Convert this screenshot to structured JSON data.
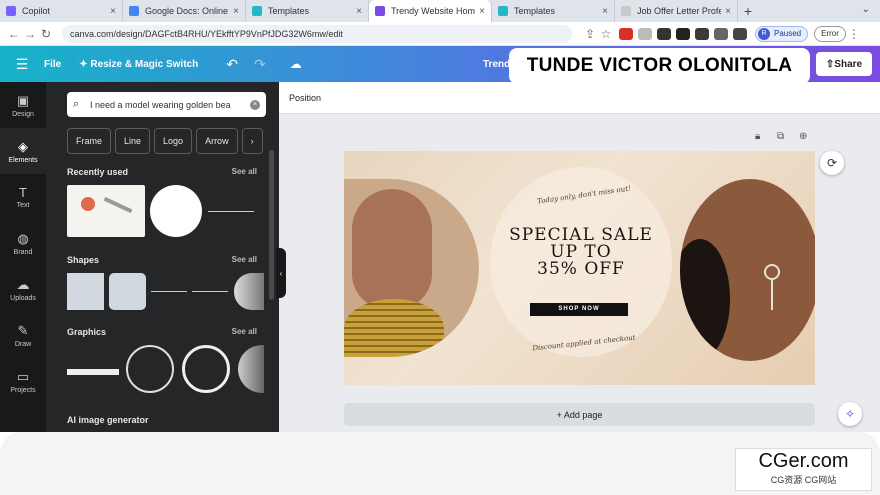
{
  "browser": {
    "tabs": [
      {
        "title": "Copilot",
        "color": "#7b61ff"
      },
      {
        "title": "Google Docs: Online D",
        "color": "#4285f4"
      },
      {
        "title": "Templates",
        "color": "#26b5c9"
      },
      {
        "title": "Trendy Website Homep",
        "color": "#7a4be0",
        "active": true
      },
      {
        "title": "Templates",
        "color": "#26b5c9"
      },
      {
        "title": "Job Offer Letter Profes",
        "color": "#c8c8c8"
      }
    ],
    "new_tab": "+",
    "url": "canva.com/design/DAGFctB4RHU/YEkfftYP9VnPfJDG32W6mw/edit",
    "profile_initial": "R",
    "paused_label": "Paused",
    "error_label": "Error"
  },
  "topbar": {
    "file_label": "File",
    "resize_label": "Resize & Magic Switch",
    "doc_title_partial": "Trend",
    "share_label": "Share"
  },
  "overlay_name": "TUNDE VICTOR OLONITOLA",
  "rail": [
    {
      "label": "Design",
      "icon": "design-icon",
      "glyph": "▣"
    },
    {
      "label": "Elements",
      "icon": "elements-icon",
      "glyph": "◈",
      "active": true
    },
    {
      "label": "Text",
      "icon": "text-icon",
      "glyph": "T"
    },
    {
      "label": "Brand",
      "icon": "brand-icon",
      "glyph": "◍"
    },
    {
      "label": "Uploads",
      "icon": "uploads-icon",
      "glyph": "☁"
    },
    {
      "label": "Draw",
      "icon": "draw-icon",
      "glyph": "✎"
    },
    {
      "label": "Projects",
      "icon": "projects-icon",
      "glyph": "▭"
    }
  ],
  "panel": {
    "search_value": "I need a model wearing golden bea",
    "chips": [
      "Frame",
      "Line",
      "Logo",
      "Arrow",
      "›"
    ],
    "recently_used": "Recently used",
    "shapes": "Shapes",
    "graphics": "Graphics",
    "ai_generator": "AI image generator",
    "see_all": "See all"
  },
  "editor": {
    "position_label": "Position",
    "add_page": "+ Add page"
  },
  "design": {
    "small_top": "Today only, don't miss out!",
    "headline": [
      "SPECIAL SALE",
      "UP TO",
      "35% OFF"
    ],
    "shop_now": "SHOP NOW",
    "small_bottom": "Discount applied at checkout"
  },
  "watermark": {
    "main": "CGer.com",
    "sub": "CG资源  CG网站"
  }
}
